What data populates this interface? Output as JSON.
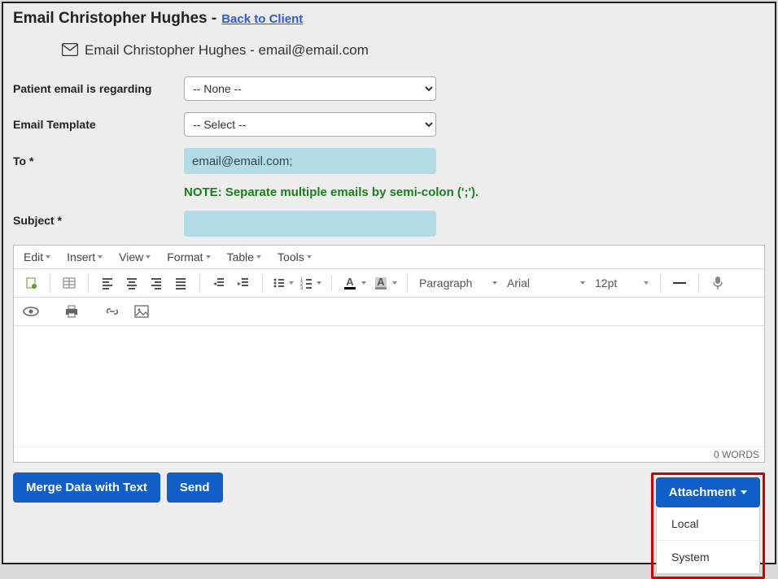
{
  "page": {
    "title_prefix": "Email Christopher Hughes",
    "title_sep": " - ",
    "back_link": "Back to Client",
    "inner_title": "Email Christopher Hughes - email@email.com"
  },
  "form": {
    "patient_label": "Patient email is regarding",
    "patient_value": "-- None --",
    "template_label": "Email Template",
    "template_value": "-- Select --",
    "to_label": "To *",
    "to_value": "email@email.com;",
    "note": "NOTE: Separate multiple emails by semi-colon (';').",
    "subject_label": "Subject *",
    "subject_value": ""
  },
  "editor": {
    "menus": {
      "edit": "Edit",
      "insert": "Insert",
      "view": "View",
      "format": "Format",
      "table": "Table",
      "tools": "Tools"
    },
    "dropdowns": {
      "paragraph": "Paragraph",
      "font": "Arial",
      "size": "12pt"
    },
    "footer_words": "0 WORDS"
  },
  "buttons": {
    "merge": "Merge Data with Text",
    "send": "Send",
    "attachment": "Attachment",
    "attach_options": {
      "local": "Local",
      "system": "System"
    }
  }
}
